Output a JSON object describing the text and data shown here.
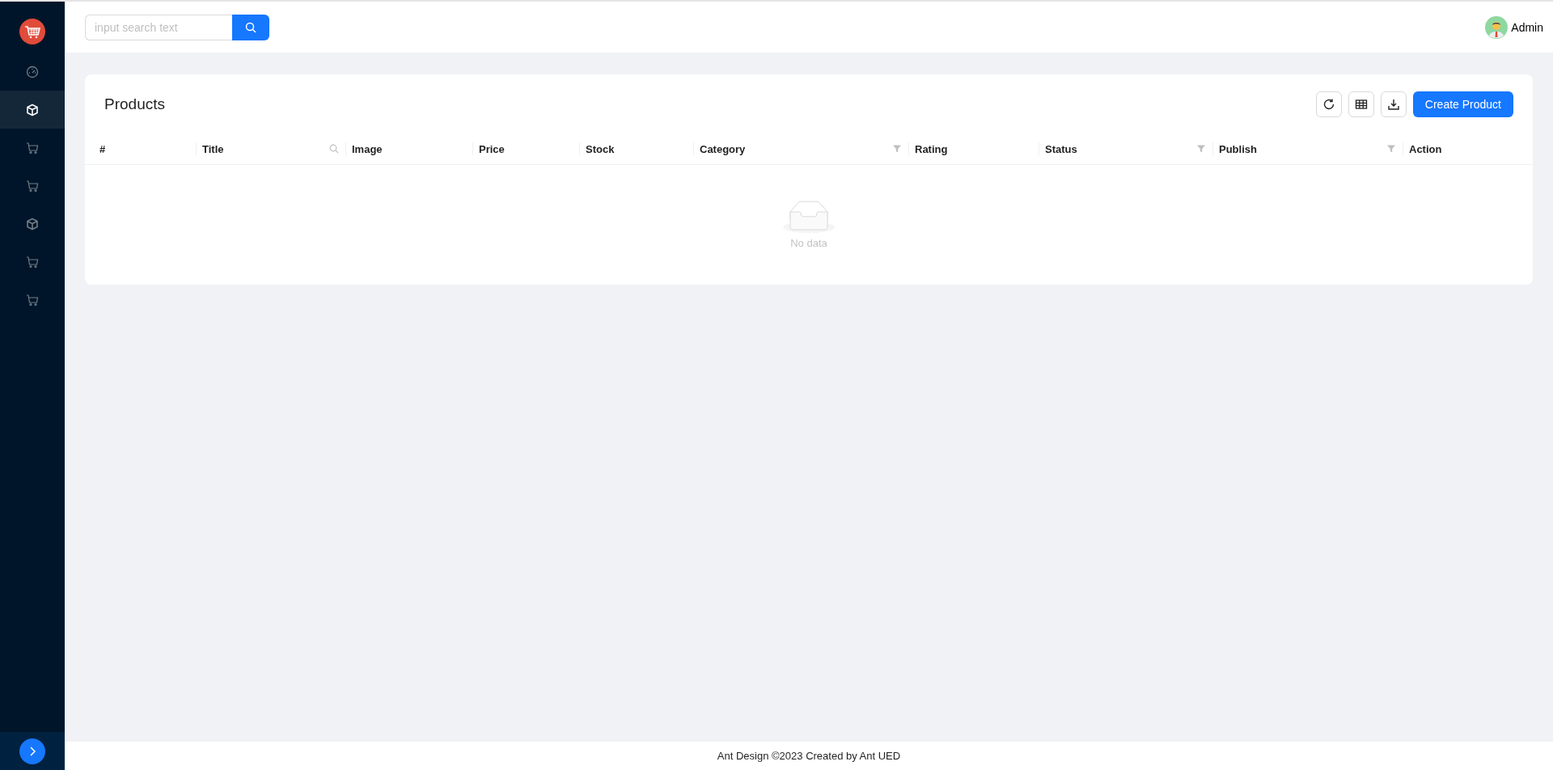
{
  "sidebar": {
    "items": [
      {
        "kind": "gauge",
        "selected": false
      },
      {
        "kind": "cube",
        "selected": true
      },
      {
        "kind": "cart",
        "selected": false
      },
      {
        "kind": "cart",
        "selected": false
      },
      {
        "kind": "cube",
        "selected": false
      },
      {
        "kind": "cart",
        "selected": false
      },
      {
        "kind": "cart",
        "selected": false
      }
    ]
  },
  "header": {
    "search": {
      "placeholder": "input search text"
    },
    "user": {
      "name": "Admin"
    }
  },
  "card": {
    "title": "Products",
    "toolbar": [
      {
        "kind": "reload"
      },
      {
        "kind": "columns"
      },
      {
        "kind": "download"
      }
    ],
    "primary_button": "Create Product",
    "table": {
      "columns": [
        {
          "label": "#",
          "kind": "plain"
        },
        {
          "label": "Title",
          "kind": "search"
        },
        {
          "label": "Image",
          "kind": "plain"
        },
        {
          "label": "Price",
          "kind": "plain"
        },
        {
          "label": "Stock",
          "kind": "plain"
        },
        {
          "label": "Category",
          "kind": "filter"
        },
        {
          "label": "Rating",
          "kind": "plain"
        },
        {
          "label": "Status",
          "kind": "filter"
        },
        {
          "label": "Publish",
          "kind": "filter"
        },
        {
          "label": "Action",
          "kind": "plain"
        }
      ],
      "empty_text": "No data"
    }
  },
  "footer": "Ant Design ©2023 Created by Ant UED"
}
